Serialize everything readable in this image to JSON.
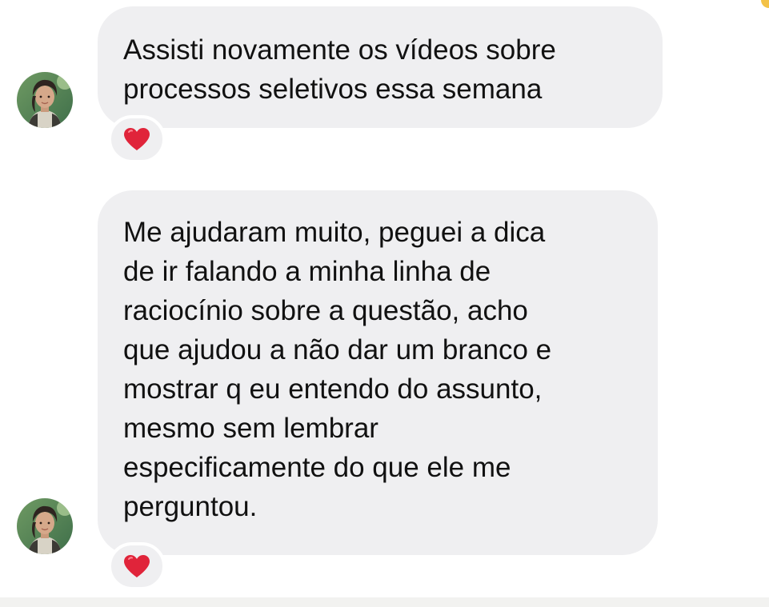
{
  "messages": [
    {
      "lines": [
        "Assisti novamente os vídeos sobre",
        "processos seletivos essa semana"
      ],
      "reaction": "red-heart-icon"
    },
    {
      "lines": [
        "Me ajudaram muito, peguei a dica",
        "de ir falando a minha linha de",
        "raciocínio sobre a questão, acho",
        "que ajudou a não dar um branco e",
        "mostrar q eu entendo do assunto,",
        "mesmo sem lembrar",
        "especificamente do que ele me",
        "perguntou."
      ],
      "reaction": "red-heart-icon"
    }
  ],
  "colors": {
    "bubble_background": "#efeff1",
    "text": "#111111",
    "heart": "#e0243a",
    "accent": "#f3c247"
  }
}
